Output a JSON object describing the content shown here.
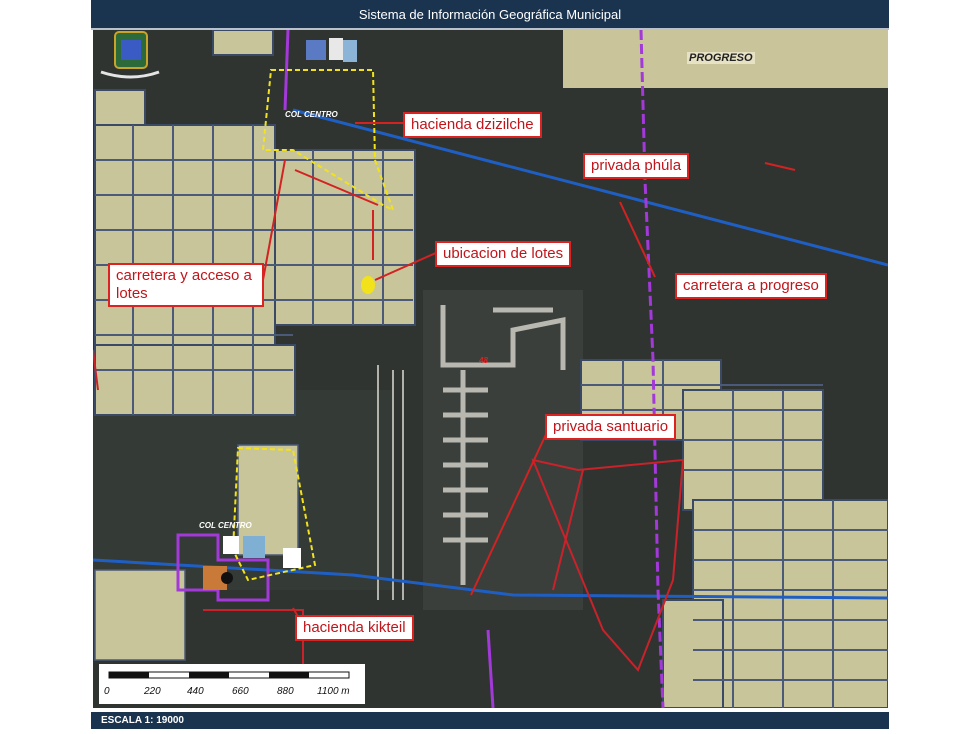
{
  "app": {
    "title": "Sistema de Información Geográfica Municipal"
  },
  "status": {
    "scale_text": "ESCALA 1: 19000"
  },
  "map": {
    "place_labels": {
      "progreso": "PROGRESO",
      "col_centro_top": "COL CENTRO",
      "col_centro_bottom": "COL CENTRO",
      "code_48": "48"
    },
    "callouts": {
      "hacienda_dzizilche": "hacienda dzizilche",
      "privada_phula": "privada phúla",
      "ubicacion_lotes": "ubicacion de lotes",
      "carretera_acceso": "carretera y acceso a lotes",
      "carretera_progreso": "carretera a progreso",
      "privada_santuario": "privada santuario",
      "hacienda_kikteil": "hacienda kikteil"
    },
    "scale": {
      "ticks": [
        "0",
        "220",
        "440",
        "660",
        "880",
        "1100 m"
      ]
    },
    "colors": {
      "road_blue": "#1f5fc4",
      "boundary_purple": "#a239d8",
      "lot_fill": "#c9c59a",
      "callout_red": "#d22222",
      "highlight_yellow": "#f1e21c"
    }
  }
}
